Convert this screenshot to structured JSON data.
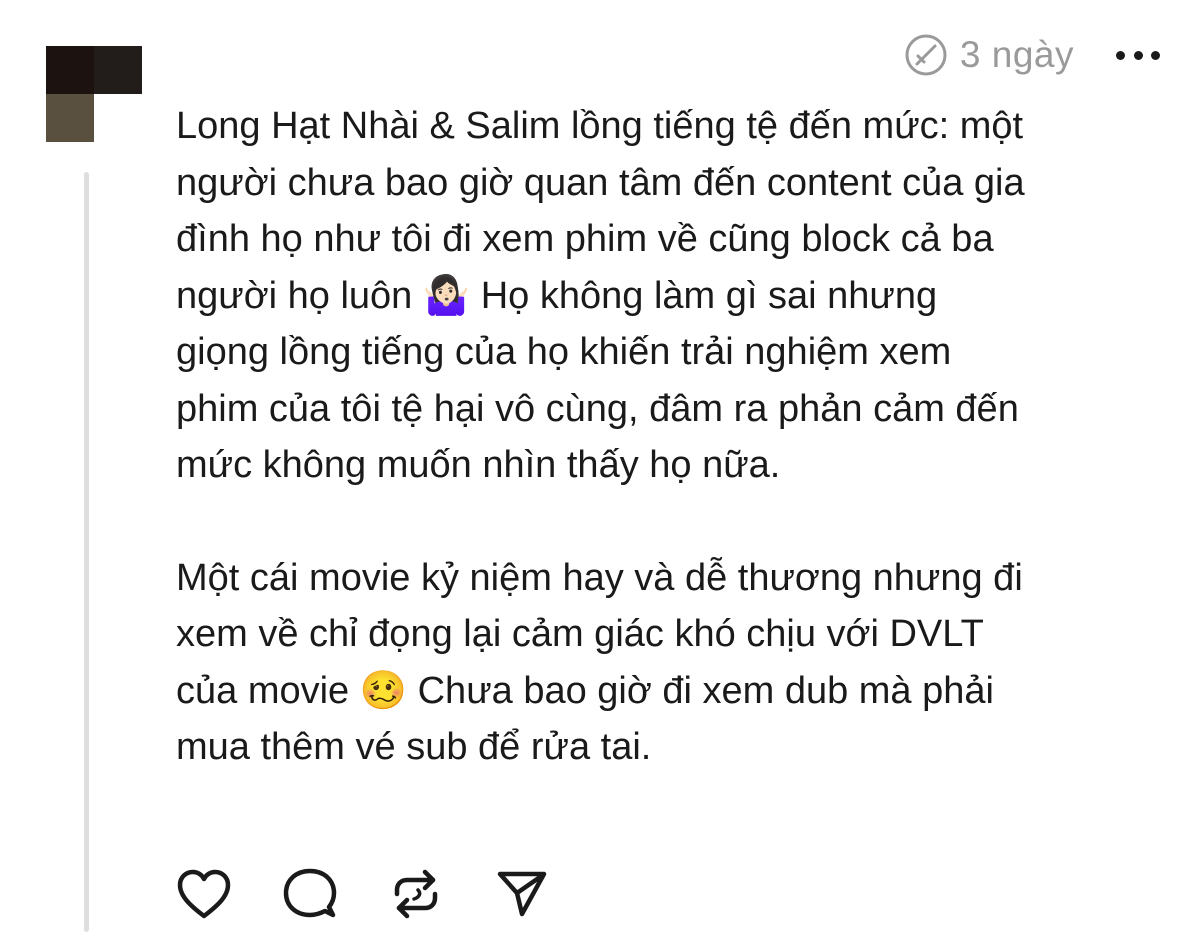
{
  "post": {
    "time_ago": "3 ngày",
    "paragraphs": [
      "Long Hạt Nhài & Salim lồng tiếng tệ đến mức: một\nngười chưa bao giờ quan tâm đến content của gia\nđình họ như tôi đi xem phim về cũng block cả ba\nngười họ luôn 🤷🏻‍♀️ Họ không làm gì sai nhưng\ngiọng lồng tiếng của họ khiến trải nghiệm xem\nphim của tôi tệ hại vô cùng, đâm ra phản cảm đến\nmức không muốn nhìn thấy họ nữa.",
      "Một cái movie kỷ niệm hay và dễ thương nhưng đi\nxem về chỉ đọng lại cảm giác khó chịu với DVLT\ncủa movie 🥴 Chưa bao giờ đi xem dub mà phải\nmua thêm vé sub để rửa tai."
    ]
  },
  "icons": {
    "edited": "edited-check-icon",
    "more": "more-dots-icon",
    "like": "heart-icon",
    "reply": "speech-bubble-icon",
    "repost": "repost-arrows-icon",
    "share": "send-icon"
  },
  "colors": {
    "text": "#1a1a1a",
    "muted": "#9a9a9a",
    "thread_line": "#dedede",
    "avatar_pixels": [
      "#1c1210",
      "#221c1a",
      "#5a5040",
      "#ffffff"
    ]
  }
}
